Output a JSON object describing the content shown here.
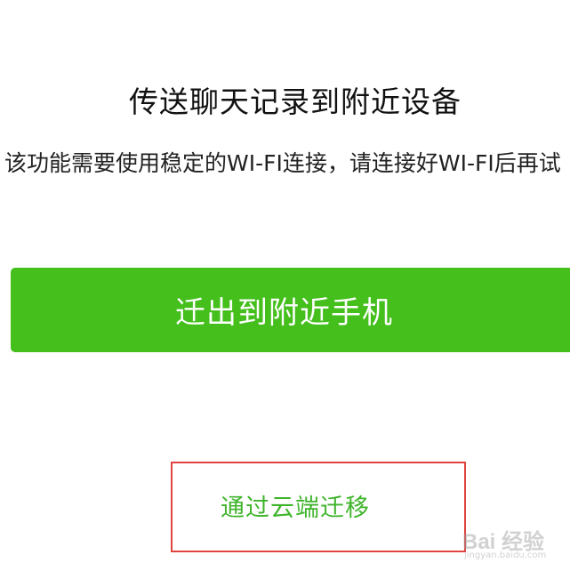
{
  "page": {
    "title": "传送聊天记录到附近设备",
    "description": "该功能需要使用稳定的WI-FI连接，请连接好WI-FI后再试"
  },
  "actions": {
    "primary_label": "迁出到附近手机",
    "primary_color": "#44bf1c",
    "cloud_label": "通过云端迁移",
    "cloud_color": "#3fb42b"
  },
  "annotation": {
    "highlight_color": "#e0443e"
  },
  "watermark": {
    "logo_text": "Bai 经验",
    "url": "jingyan.baidu.com"
  }
}
